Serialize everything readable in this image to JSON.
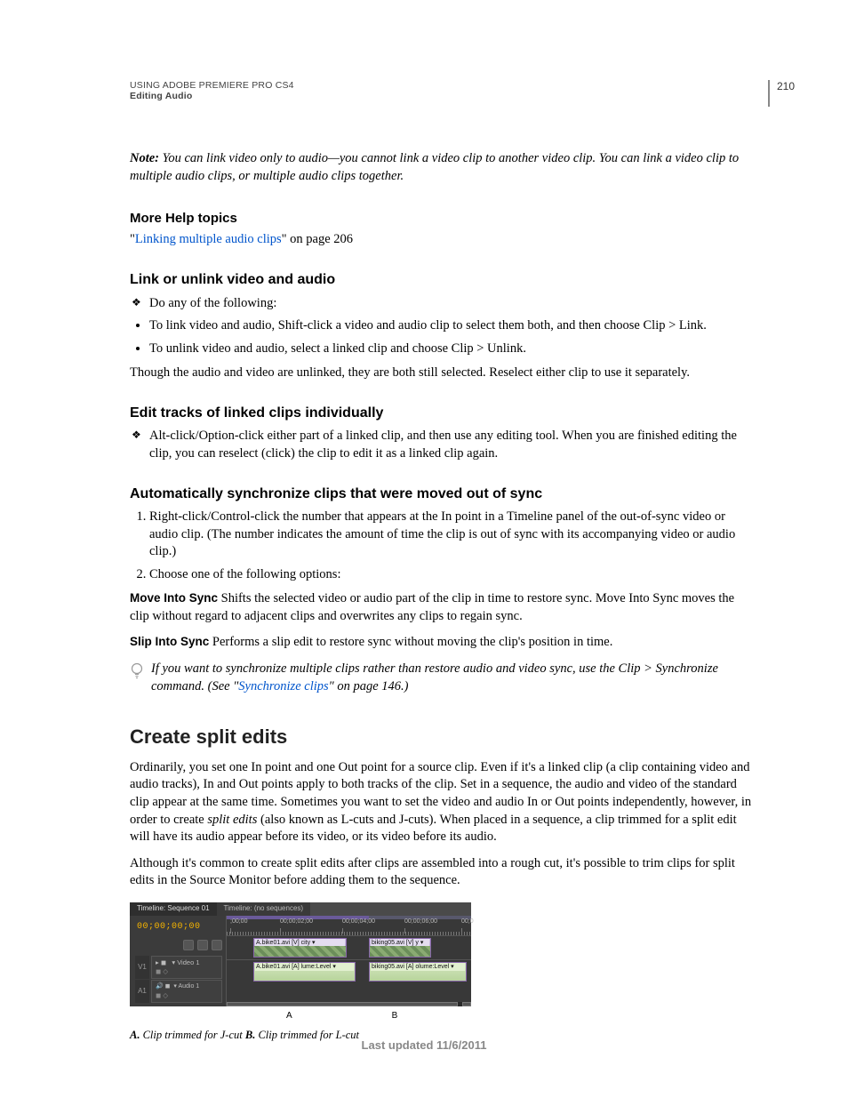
{
  "header": {
    "doc_title": "USING ADOBE PREMIERE PRO CS4",
    "chapter": "Editing Audio",
    "page_number": "210"
  },
  "note": {
    "label": "Note:",
    "text": " You can link video only to audio—you cannot link a video clip to another video clip. You can link a video clip to multiple audio clips, or multiple audio clips together."
  },
  "more_help": {
    "heading": "More Help topics",
    "link_text": "Linking multiple audio clips",
    "suffix": "\" on page 206",
    "prefix": "\""
  },
  "s1": {
    "heading": "Link or unlink video and audio",
    "lead": "Do any of the following:",
    "b1": "To link video and audio, Shift-click a video and audio clip to select them both, and then choose Clip > Link.",
    "b2": "To unlink video and audio, select a linked clip and choose Clip > Unlink.",
    "after": "Though the audio and video are unlinked, they are both still selected. Reselect either clip to use it separately."
  },
  "s2": {
    "heading": "Edit tracks of linked clips individually",
    "item": "Alt-click/Option-click either part of a linked clip, and then use any editing tool. When you are finished editing the clip, you can reselect (click) the clip to edit it as a linked clip again."
  },
  "s3": {
    "heading": "Automatically synchronize clips that were moved out of sync",
    "n1": "Right-click/Control-click the number that appears at the In point in a Timeline panel of the out-of-sync video or audio clip. (The number indicates the amount of time the clip is out of sync with its accompanying video or audio clip.)",
    "n2": "Choose one of the following options:",
    "opt1_label": "Move Into Sync",
    "opt1_text": "  Shifts the selected video or audio part of the clip in time to restore sync. Move Into Sync moves the clip without regard to adjacent clips and overwrites any clips to regain sync.",
    "opt2_label": "Slip Into Sync",
    "opt2_text": "  Performs a slip edit to restore sync without moving the clip's position in time.",
    "tip_pre": "If you want to synchronize multiple clips rather than restore audio and video sync, use the Clip > Synchronize command. (See \"",
    "tip_link": "Synchronize clips",
    "tip_post": "\" on page 146.)"
  },
  "s4": {
    "heading": "Create split edits",
    "p1a": "Ordinarily, you set one In point and one Out point for a source clip. Even if it's a linked clip (a clip containing video and audio tracks), In and Out points apply to both tracks of the clip. Set in a sequence, the audio and video of the standard clip appear at the same time. Sometimes you want to set the video and audio In or Out points independently, however, in order to create ",
    "p1_em": "split edits",
    "p1b": " (also known as L-cuts and J-cuts). When placed in a sequence, a clip trimmed for a split edit will have its audio appear before its video, or its video before its audio.",
    "p2": "Although it's common to create split edits after clips are assembled into a rough cut, it's possible to trim clips for split edits in the Source Monitor before adding them to the sequence."
  },
  "figure": {
    "tab1": "Timeline: Sequence 01",
    "tab2": "Timeline: (no sequences)",
    "timecode": "00;00;00;00",
    "ruler": {
      "t0": ";00;00",
      "t1": "00;00;02;00",
      "t2": "00;00;04;00",
      "t3": "00;00;06;00",
      "t4": "00;0"
    },
    "track_v_label": "V1",
    "track_v_name": "Video 1",
    "track_a_label": "A1",
    "track_a_name": "Audio 1",
    "clipA_v": "A.bike01.avi [V] city ▾",
    "clipA_a": "A.bike01.avi [A] lume:Level ▾",
    "clipB_v": "biking05.avi [V] y ▾",
    "clipB_a": "biking05.avi [A] olume:Level ▾",
    "legend_A": "A",
    "legend_B": "B",
    "caption_A_label": "A.",
    "caption_A_text": " Clip trimmed for J-cut  ",
    "caption_B_label": "B.",
    "caption_B_text": " Clip trimmed for L-cut"
  },
  "footer": "Last updated 11/6/2011"
}
